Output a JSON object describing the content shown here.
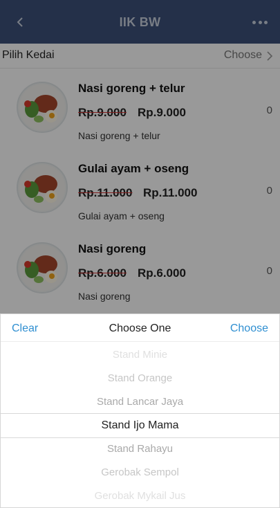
{
  "header": {
    "title": "IIK BW",
    "back_icon": "chevron-left-icon",
    "more_icon": "more-horizontal-icon"
  },
  "shop": {
    "label": "Pilih Kedai",
    "value": "Choose",
    "chevron_icon": "chevron-right-icon"
  },
  "products": [
    {
      "name": "Nasi goreng + telur",
      "old_price": "Rp.9.000",
      "price": "Rp.9.000",
      "desc": "Nasi goreng + telur",
      "qty": "0"
    },
    {
      "name": "Gulai ayam + oseng",
      "old_price": "Rp.11.000",
      "price": "Rp.11.000",
      "desc": "Gulai ayam + oseng",
      "qty": "0"
    },
    {
      "name": "Nasi goreng",
      "old_price": "Rp.6.000",
      "price": "Rp.6.000",
      "desc": "Nasi goreng",
      "qty": "0"
    }
  ],
  "picker": {
    "clear_label": "Clear",
    "title": "Choose One",
    "choose_label": "Choose",
    "options": [
      "Stand Minie",
      "Stand Orange",
      "Stand Lancar Jaya",
      "Stand Ijo Mama",
      "Stand Rahayu",
      "Gerobak Sempol",
      "Gerobak Mykail Jus"
    ],
    "selected": "Stand Ijo Mama"
  },
  "colors": {
    "header_bg": "#3d507a",
    "accent": "#2f8fd1",
    "strike": "#d43333"
  }
}
